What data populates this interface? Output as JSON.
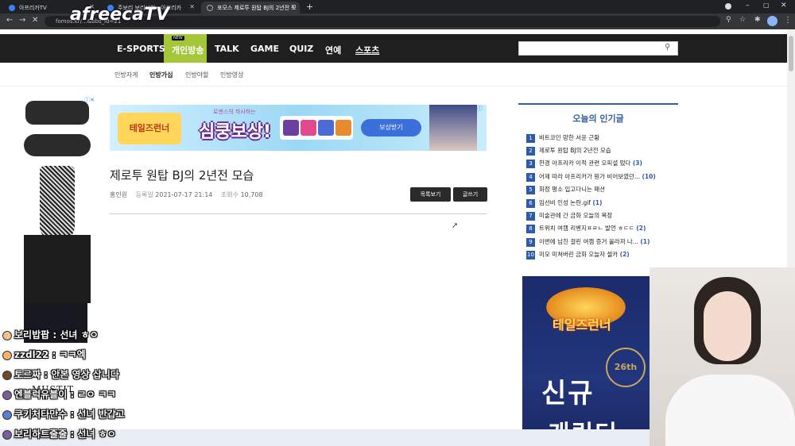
{
  "browser": {
    "tabs": [
      {
        "label": "아프리카TV"
      },
      {
        "label": "주보리 보리시청 - 아프리카"
      },
      {
        "label": "포모스 제로투 원탑 BJ의 2년전 모"
      }
    ],
    "url": "fomos.kr/...&bbs_id=21"
  },
  "overlay": {
    "logo": "afreecaTV"
  },
  "site": {
    "nav": [
      "E-SPORTS",
      "개인방송",
      "TALK",
      "GAME",
      "QUIZ",
      "연예",
      "스포츠"
    ],
    "new_badge": "NEW",
    "subnav": [
      "인방자게",
      "인방가십",
      "인방야할",
      "인방영상"
    ]
  },
  "banner": {
    "small": "로맨스의 하사하는",
    "big": "심쿵보상!",
    "button": "보상받기",
    "game": "테일즈런너"
  },
  "post": {
    "title": "제로투 원탑 BJ의 2년전 모습",
    "author": "홍인원",
    "date_label": "등록일",
    "date": "2021-07-17 21:14",
    "views_label": "조회수",
    "views": "10,708",
    "list_button": "목록보기",
    "write_button": "글쓰기"
  },
  "popular": {
    "title": "오늘의 인기글",
    "items": [
      {
        "num": "1",
        "text": "비트코인 망한 서윤 근황",
        "count": ""
      },
      {
        "num": "2",
        "text": "제로투 원탑 BJ의 2년전 모습",
        "count": ""
      },
      {
        "num": "3",
        "text": "한경 아프리카 이적 관련 오피셜 떴다",
        "count": "(3)"
      },
      {
        "num": "4",
        "text": "어제 따라 아프리카가 뭔가 비어보였던...",
        "count": "(10)"
      },
      {
        "num": "5",
        "text": "화정 평소 입고다니는 패션",
        "count": ""
      },
      {
        "num": "6",
        "text": "임선비 인성 논란.gif",
        "count": "(1)"
      },
      {
        "num": "7",
        "text": "미술관에 간 금화 오늘의 복장",
        "count": ""
      },
      {
        "num": "8",
        "text": "트위치 여캠 리벤지ㅍㄹㄴ 발언 ㅎㄷㄷ",
        "count": "(2)"
      },
      {
        "num": "9",
        "text": "이번에 남친 걸린 여캠 증거 올라져 나...",
        "count": "(1)"
      },
      {
        "num": "10",
        "text": "미모 미쳐버린 금화 오늘자 셀카",
        "count": "(2)"
      }
    ]
  },
  "right_ad": {
    "game": "테일즈런너",
    "badge": "26th",
    "big": "신규",
    "big2": "캐릭터"
  },
  "left_ad": {
    "brand": "MUSTIT"
  },
  "chat": [
    {
      "user": "보리밥팝",
      "msg": " : 선녀 ㅎㅇ"
    },
    {
      "user": "zzdl22",
      "msg": " : ㅋㅋ엑"
    },
    {
      "user": "토르짜",
      "msg": " : 안본 영상 삽니다"
    },
    {
      "user": "엔블럭유블이",
      "msg": " : ㄹㅇ ㅋㅋ"
    },
    {
      "user": "쿠키처타만수",
      "msg": " : 선녀 반갑고"
    },
    {
      "user": "보리하트줄줄",
      "msg": " : 선녀 ㅎㅇ"
    }
  ]
}
